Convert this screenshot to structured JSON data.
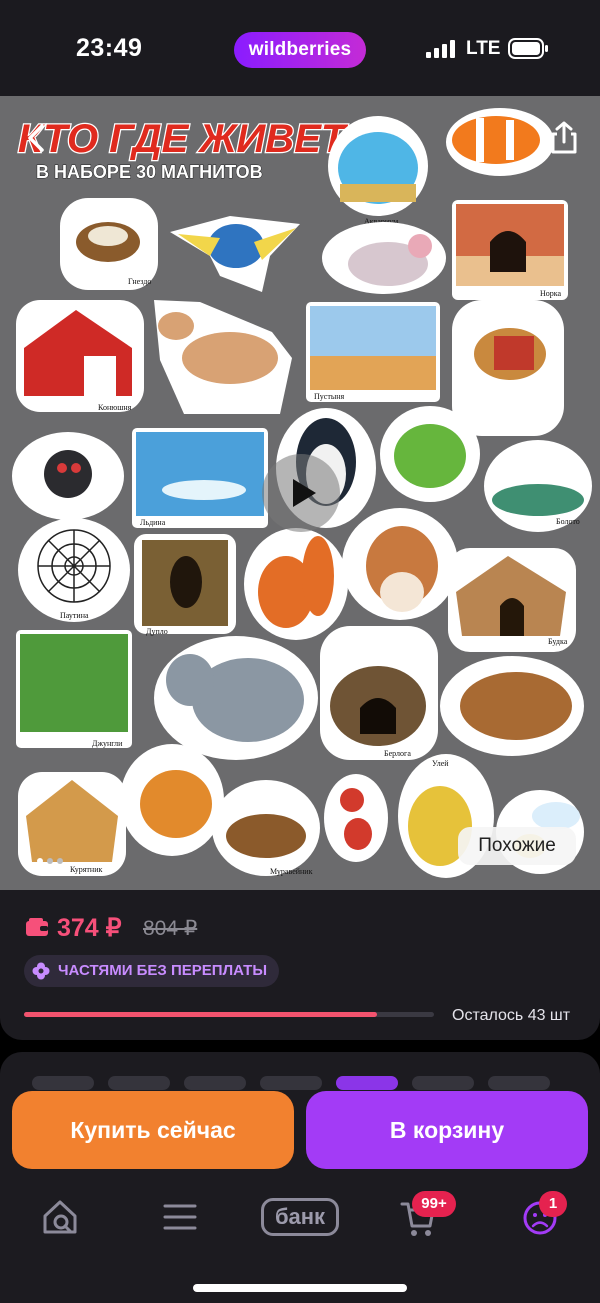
{
  "status_bar": {
    "time": "23:49",
    "app_pill": "wildberries",
    "network": "LTE"
  },
  "product_image": {
    "title_line1": "КТО ГДЕ ЖИВЕТ?",
    "title_line2": "В НАБОРЕ 30 МАГНИТОВ",
    "labels": [
      "Аквариум",
      "Гнездо",
      "Норка",
      "Конюшня",
      "Пустыня",
      "Льдина",
      "Болото",
      "Паутина",
      "Дупло",
      "Будка",
      "Джунгли",
      "Берлога",
      "Улей",
      "Курятник",
      "Муравейник"
    ],
    "similar_label": "Похожие"
  },
  "price": {
    "current": "374 ₽",
    "old": "804 ₽",
    "installments_label": "ЧАСТЯМИ БЕЗ ПЕРЕПЛАТЫ",
    "stock_text": "Осталось 43 шт",
    "stock_fraction": 0.86
  },
  "actions": {
    "buy_now": "Купить сейчас",
    "add_to_cart": "В корзину"
  },
  "tab_bar": {
    "bank_label": "банк",
    "cart_badge": "99+",
    "profile_badge": "1"
  },
  "colors": {
    "price": "#f6507a",
    "buy_button": "#f2812f",
    "cart_button": "#a33bf6",
    "badge": "#e5224f",
    "installments_text": "#c88cff"
  },
  "icons": [
    "back-icon",
    "share-icon",
    "play-icon",
    "wallet-icon",
    "flower-icon",
    "home-search-icon",
    "menu-icon",
    "cart-icon",
    "profile-icon"
  ]
}
